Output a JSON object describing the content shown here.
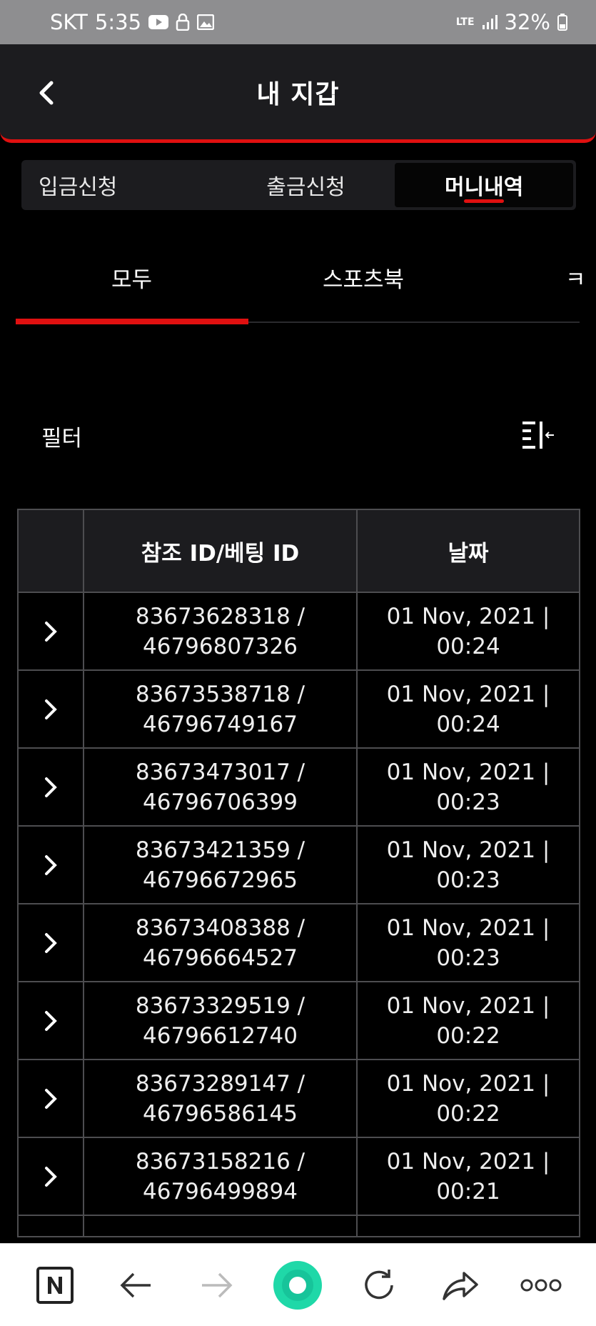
{
  "status_bar": {
    "carrier": "SKT",
    "time": "5:35",
    "network": "LTE",
    "battery": "32%"
  },
  "header": {
    "title": "내 지갑"
  },
  "wallet_tabs": [
    {
      "label": "입금신청",
      "active": false
    },
    {
      "label": "출금신청",
      "active": false
    },
    {
      "label": "머니내역",
      "active": true
    }
  ],
  "sub_tabs": [
    {
      "label": "모두",
      "active": true
    },
    {
      "label": "스포츠북",
      "active": false
    },
    {
      "label": "ㅋ",
      "active": false
    }
  ],
  "filter": {
    "label": "필터"
  },
  "table": {
    "headers": [
      "참조 ID/베팅 ID",
      "날짜"
    ],
    "rows": [
      {
        "ref": "83673628318 /",
        "bet": "46796807326",
        "date": "01 Nov, 2021 |",
        "time": "00:24"
      },
      {
        "ref": "83673538718 /",
        "bet": "46796749167",
        "date": "01 Nov, 2021 |",
        "time": "00:24"
      },
      {
        "ref": "83673473017 /",
        "bet": "46796706399",
        "date": "01 Nov, 2021 |",
        "time": "00:23"
      },
      {
        "ref": "83673421359 /",
        "bet": "46796672965",
        "date": "01 Nov, 2021 |",
        "time": "00:23"
      },
      {
        "ref": "83673408388 /",
        "bet": "46796664527",
        "date": "01 Nov, 2021 |",
        "time": "00:23"
      },
      {
        "ref": "83673329519 /",
        "bet": "46796612740",
        "date": "01 Nov, 2021 |",
        "time": "00:22"
      },
      {
        "ref": "83673289147 /",
        "bet": "46796586145",
        "date": "01 Nov, 2021 |",
        "time": "00:22"
      },
      {
        "ref": "83673158216 /",
        "bet": "46796499894",
        "date": "01 Nov, 2021 |",
        "time": "00:21"
      }
    ]
  },
  "colors": {
    "accent": "#e01010",
    "background": "#000000",
    "surface": "#1c1c1f",
    "nav_home": "#1fd8a8"
  },
  "bottom_nav": {
    "icons": [
      "naver-n-icon",
      "back-arrow-icon",
      "forward-arrow-icon",
      "home-dot-icon",
      "refresh-icon",
      "share-icon",
      "more-icon"
    ]
  }
}
